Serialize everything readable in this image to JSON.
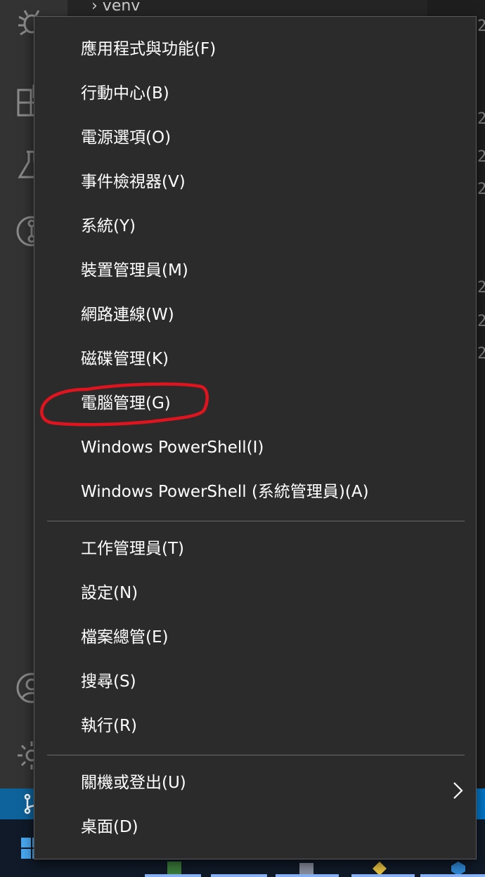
{
  "background": {
    "explorer_item": "venv",
    "line_number_char": "2"
  },
  "menu": {
    "items": [
      {
        "label": "應用程式與功能(F)"
      },
      {
        "label": "行動中心(B)"
      },
      {
        "label": "電源選項(O)"
      },
      {
        "label": "事件檢視器(V)"
      },
      {
        "label": "系統(Y)"
      },
      {
        "label": "裝置管理員(M)"
      },
      {
        "label": "網路連線(W)"
      },
      {
        "label": "磁碟管理(K)"
      },
      {
        "label": "電腦管理(G)"
      },
      {
        "label": "Windows PowerShell(I)"
      },
      {
        "label": "Windows PowerShell (系統管理員)(A)"
      },
      {
        "label": "工作管理員(T)"
      },
      {
        "label": "設定(N)"
      },
      {
        "label": "檔案總管(E)"
      },
      {
        "label": "搜尋(S)"
      },
      {
        "label": "執行(R)"
      },
      {
        "label": "關機或登出(U)"
      },
      {
        "label": "桌面(D)"
      }
    ],
    "highlighted_item": "電腦管理(G)"
  },
  "colors": {
    "menu_bg": "#2b2b2b",
    "menu_text": "#ffffff",
    "annotation": "#e0141e",
    "status_bar": "#007acc",
    "taskbar": "#101a28"
  },
  "icons": {
    "activity_bar": [
      "debug-icon",
      "extensions-icon",
      "flask-icon",
      "git-graph-icon",
      "account-icon",
      "settings-gear-icon"
    ],
    "status_bar": "source-control-branch-icon",
    "taskbar": "windows-start-icon",
    "submenu": "chevron-right-icon"
  }
}
